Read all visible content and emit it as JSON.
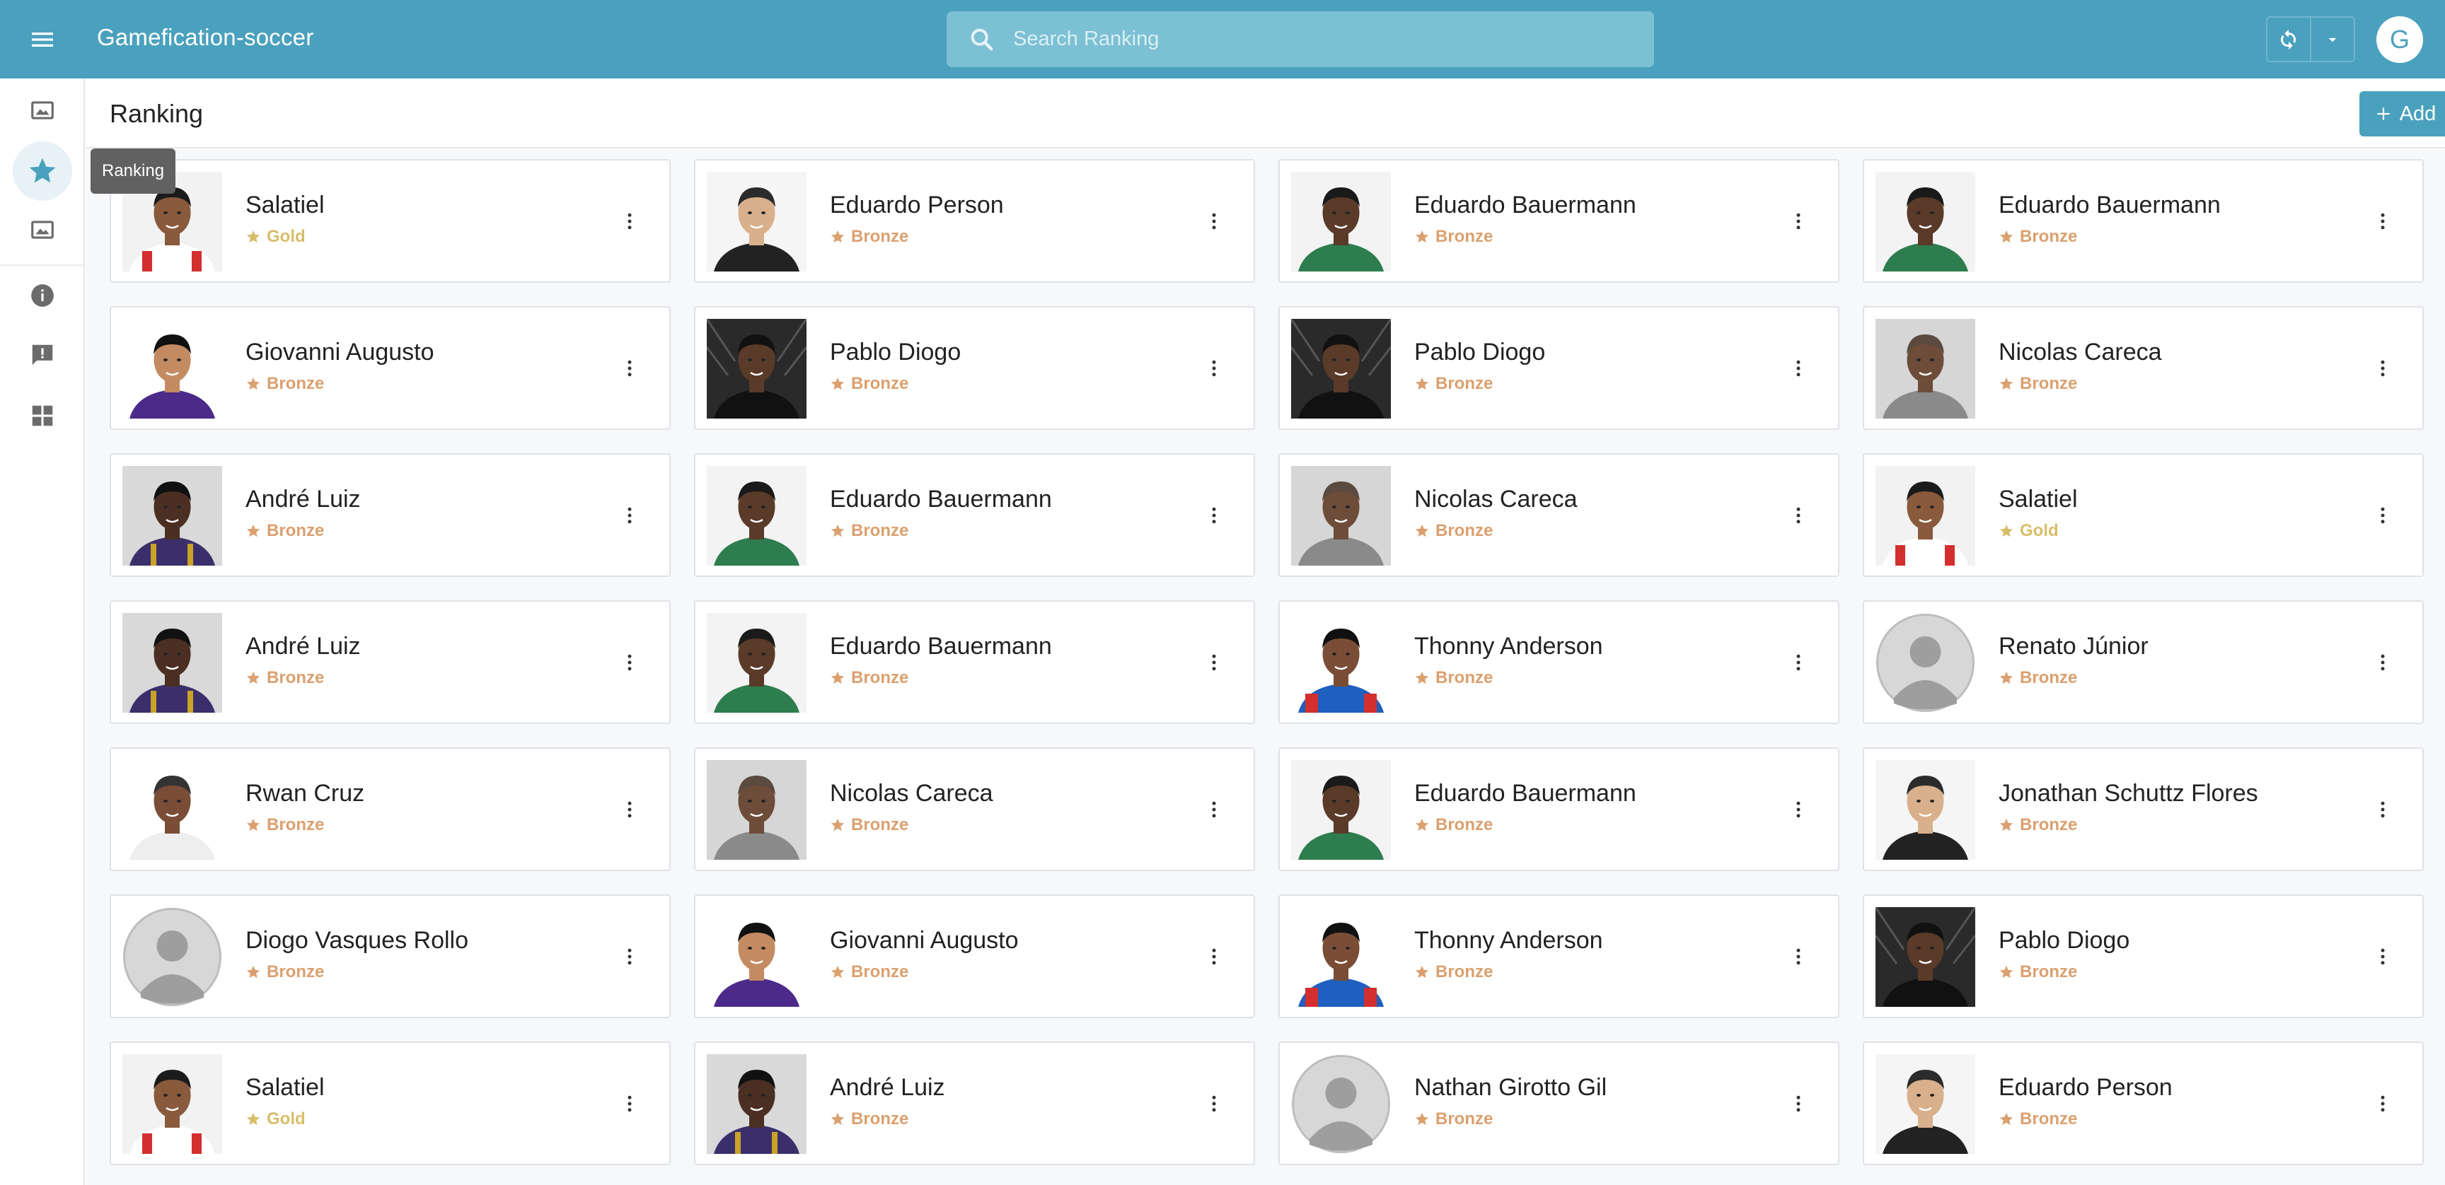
{
  "app": {
    "title": "Gamefication-soccer",
    "user_initial": "G",
    "accent": "#4aa1be"
  },
  "search": {
    "placeholder": "Search Ranking"
  },
  "sidebar": {
    "items": [
      {
        "icon": "image-icon",
        "name": "sidebar-item-images"
      },
      {
        "icon": "star-icon",
        "name": "sidebar-item-ranking",
        "active": true
      },
      {
        "icon": "image-icon",
        "name": "sidebar-item-gallery"
      },
      {
        "icon": "info-icon",
        "name": "sidebar-item-info"
      },
      {
        "icon": "feedback-icon",
        "name": "sidebar-item-feedback"
      },
      {
        "icon": "dashboard-icon",
        "name": "sidebar-item-dashboard"
      }
    ],
    "tooltip": "Ranking"
  },
  "page": {
    "title": "Ranking",
    "add_label": "Add"
  },
  "colors": {
    "gold": "#d8bd6a",
    "bronze": "#dba06f"
  },
  "players": [
    {
      "name": "Salatiel",
      "level": "Gold",
      "photo": "red-white"
    },
    {
      "name": "Eduardo Person",
      "level": "Bronze",
      "photo": "black"
    },
    {
      "name": "Eduardo Bauermann",
      "level": "Bronze",
      "photo": "green"
    },
    {
      "name": "Eduardo Bauermann",
      "level": "Bronze",
      "photo": "green"
    },
    {
      "name": "Giovanni Augusto",
      "level": "Bronze",
      "photo": "purple"
    },
    {
      "name": "Pablo Diogo",
      "level": "Bronze",
      "photo": "bw"
    },
    {
      "name": "Pablo Diogo",
      "level": "Bronze",
      "photo": "bw"
    },
    {
      "name": "Nicolas Careca",
      "level": "Bronze",
      "photo": "gray"
    },
    {
      "name": "André Luiz",
      "level": "Bronze",
      "photo": "stripes"
    },
    {
      "name": "Eduardo Bauermann",
      "level": "Bronze",
      "photo": "green"
    },
    {
      "name": "Nicolas Careca",
      "level": "Bronze",
      "photo": "gray"
    },
    {
      "name": "Salatiel",
      "level": "Gold",
      "photo": "red-white"
    },
    {
      "name": "André Luiz",
      "level": "Bronze",
      "photo": "stripes"
    },
    {
      "name": "Eduardo Bauermann",
      "level": "Bronze",
      "photo": "green"
    },
    {
      "name": "Thonny Anderson",
      "level": "Bronze",
      "photo": "blue-red"
    },
    {
      "name": "Renato Júnior",
      "level": "Bronze",
      "photo": "placeholder"
    },
    {
      "name": "Rwan Cruz",
      "level": "Bronze",
      "photo": "white"
    },
    {
      "name": "Nicolas Careca",
      "level": "Bronze",
      "photo": "gray"
    },
    {
      "name": "Eduardo Bauermann",
      "level": "Bronze",
      "photo": "green"
    },
    {
      "name": "Jonathan Schuttz Flores",
      "level": "Bronze",
      "photo": "black"
    },
    {
      "name": "Diogo Vasques Rollo",
      "level": "Bronze",
      "photo": "placeholder"
    },
    {
      "name": "Giovanni Augusto",
      "level": "Bronze",
      "photo": "purple"
    },
    {
      "name": "Thonny Anderson",
      "level": "Bronze",
      "photo": "blue-red"
    },
    {
      "name": "Pablo Diogo",
      "level": "Bronze",
      "photo": "bw"
    },
    {
      "name": "Salatiel",
      "level": "Gold",
      "photo": "red-white"
    },
    {
      "name": "André Luiz",
      "level": "Bronze",
      "photo": "stripes"
    },
    {
      "name": "Nathan Girotto Gil",
      "level": "Bronze",
      "photo": "placeholder"
    },
    {
      "name": "Eduardo Person",
      "level": "Bronze",
      "photo": "black"
    }
  ]
}
